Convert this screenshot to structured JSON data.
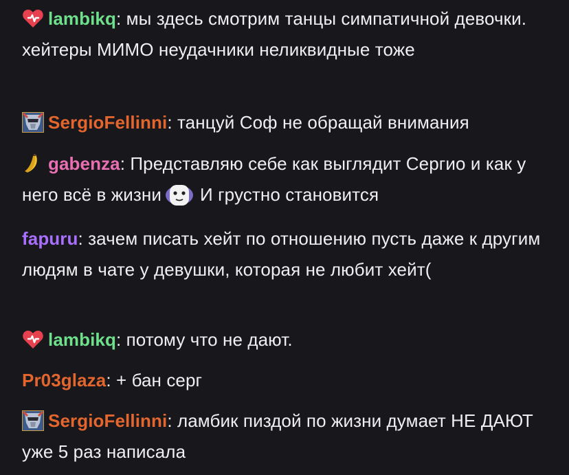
{
  "messages": [
    {
      "badge": "heart-badge-icon",
      "user": "lambikq",
      "color": "#6ee08c",
      "sep": ": ",
      "text": "мы здесь смотрим танцы симпатичной девочки. хейтеры МИМО неудачники неликвидные тоже"
    },
    {
      "badge": "helmet-avatar-badge-icon",
      "user": "SergioFellinni",
      "color": "#e3662e",
      "sep": ": ",
      "text": "танцуй Соф не обращай внимания"
    },
    {
      "badge": "banana-badge-icon",
      "user": "gabenza",
      "color": "#e86fb2",
      "sep": ": ",
      "text": "Представляю себе как выглядит Сергио и как у него всё в жизни",
      "emote": "mask-face-emote-icon",
      "text_after": "И грустно становится"
    },
    {
      "user": "fapuru",
      "color": "#a970ff",
      "sep": ": ",
      "text": "зачем писать хейт по отношению пусть даже к другим людям в чате у девушки, которая не любит хейт("
    },
    {
      "badge": "heart-badge-icon",
      "user": "lambikq",
      "color": "#6ee08c",
      "sep": ": ",
      "text": "потому что не дают."
    },
    {
      "user": "Pr03glaza",
      "color": "#e3662e",
      "sep": ": ",
      "text": "+ бан серг"
    },
    {
      "badge": "helmet-avatar-badge-icon",
      "user": "SergioFellinni",
      "color": "#e3662e",
      "sep": ": ",
      "text": "ламбик пиздой по жизни думает НЕ ДАЮТ уже 5 раз написала"
    }
  ]
}
